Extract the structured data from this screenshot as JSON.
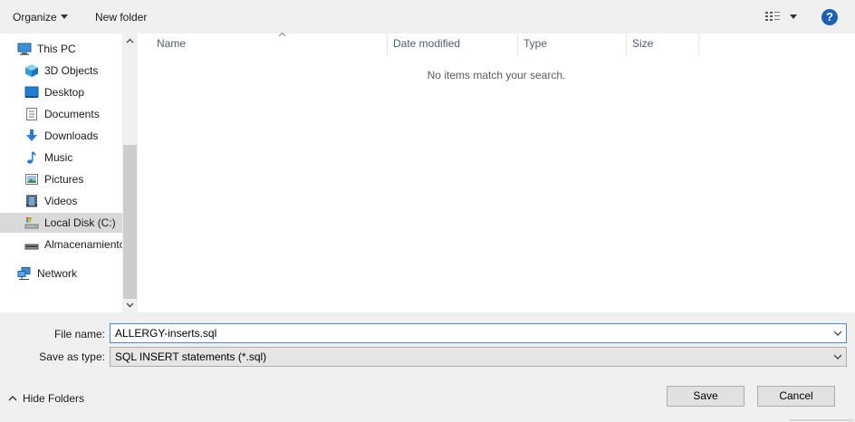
{
  "toolbar": {
    "organize_label": "Organize",
    "new_folder_label": "New folder",
    "view_icon": "view-options-icon",
    "help_label": "?"
  },
  "nav": {
    "items": [
      {
        "label": "This PC",
        "icon": "computer-icon",
        "level": 0,
        "selected": false
      },
      {
        "label": "3D Objects",
        "icon": "cube-icon",
        "level": 1,
        "selected": false
      },
      {
        "label": "Desktop",
        "icon": "desktop-icon",
        "level": 1,
        "selected": false
      },
      {
        "label": "Documents",
        "icon": "document-icon",
        "level": 1,
        "selected": false
      },
      {
        "label": "Downloads",
        "icon": "download-icon",
        "level": 1,
        "selected": false
      },
      {
        "label": "Music",
        "icon": "music-icon",
        "level": 1,
        "selected": false
      },
      {
        "label": "Pictures",
        "icon": "picture-icon",
        "level": 1,
        "selected": false
      },
      {
        "label": "Videos",
        "icon": "video-icon",
        "level": 1,
        "selected": false
      },
      {
        "label": "Local Disk (C:)",
        "icon": "drive-icon",
        "level": 1,
        "selected": true
      },
      {
        "label": "Almacenamiento",
        "icon": "usb-drive-icon",
        "level": 1,
        "selected": false
      },
      {
        "label": "Network",
        "icon": "network-icon",
        "level": 0,
        "selected": false
      }
    ]
  },
  "filelist": {
    "columns": [
      "Name",
      "Date modified",
      "Type",
      "Size"
    ],
    "empty_message": "No items match your search."
  },
  "form": {
    "filename_label": "File name:",
    "filename_value": "ALLERGY-inserts.sql",
    "savetype_label": "Save as type:",
    "savetype_value": "SQL INSERT statements (*.sql)"
  },
  "footer": {
    "hide_folders_label": "Hide Folders",
    "save_label": "Save",
    "cancel_label": "Cancel"
  },
  "colors": {
    "selection_bg": "#d9d9d9",
    "help_blue": "#1b62b5",
    "column_header_text": "#4c607a",
    "input_focus_border": "#4d8ad3"
  }
}
